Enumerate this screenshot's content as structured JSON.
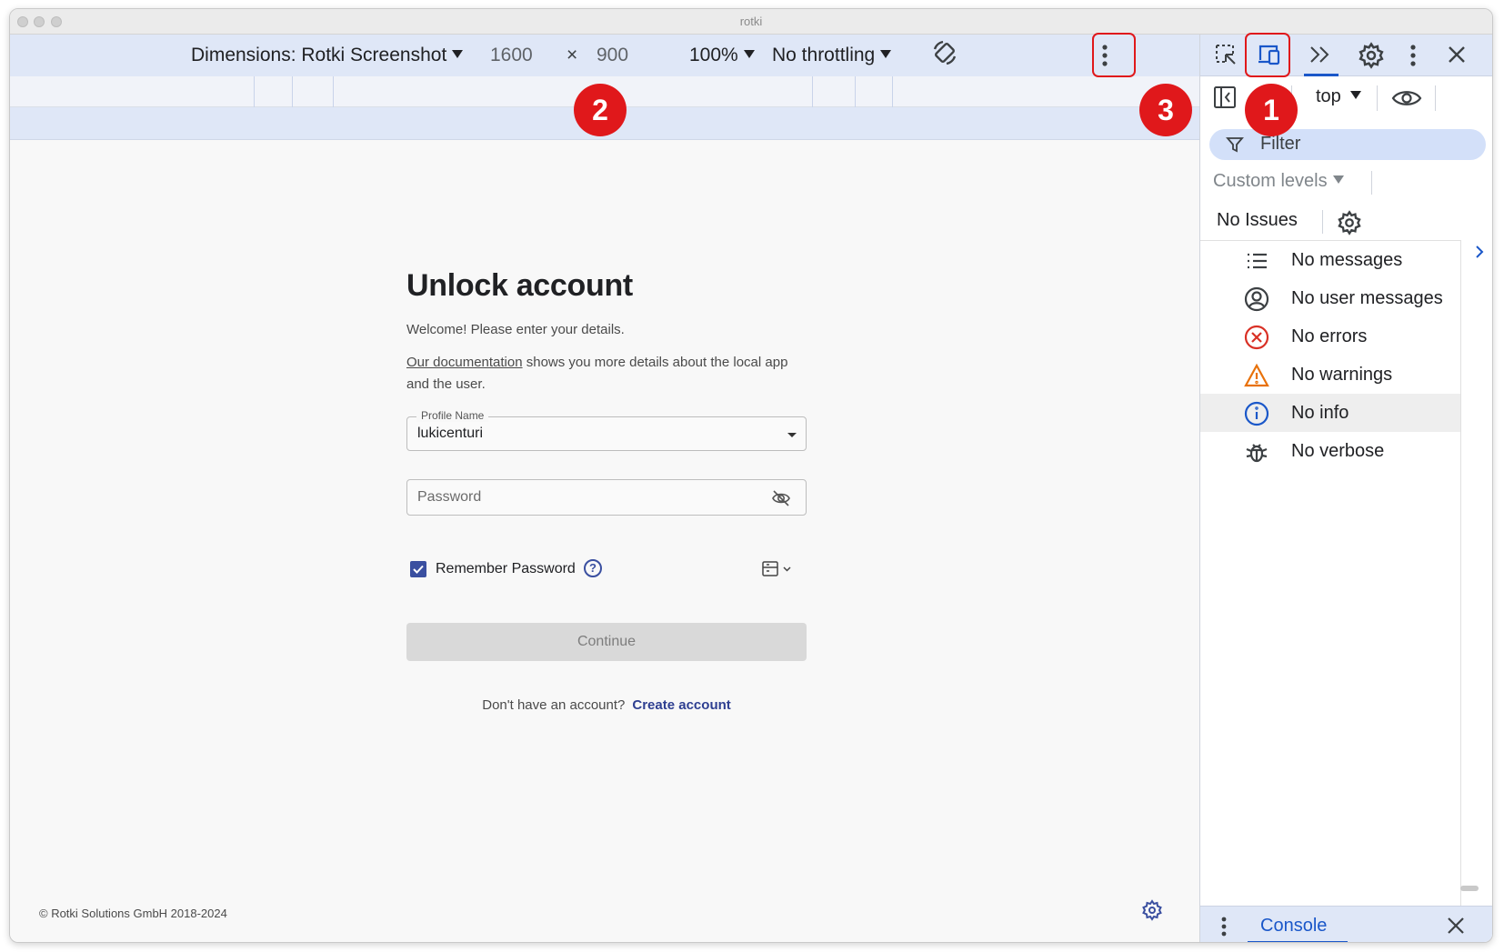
{
  "window": {
    "title": "rotki"
  },
  "device_toolbar": {
    "dimensions_label": "Dimensions: Rotki Screenshot",
    "width": "1600",
    "times": "×",
    "height": "900",
    "zoom": "100%",
    "throttling": "No throttling"
  },
  "annotations": {
    "badge1": "1",
    "badge2": "2",
    "badge3": "3",
    "color": "#e0181b"
  },
  "login": {
    "title": "Unlock account",
    "welcome": "Welcome! Please enter your details.",
    "doc_link": "Our documentation",
    "doc_text": " shows you more details about the local app and the user.",
    "profile_label": "Profile Name",
    "profile_value": "lukicenturi",
    "password_placeholder": "Password",
    "remember_label": "Remember Password",
    "continue_label": "Continue",
    "signup_prompt": "Don't have an account?",
    "create_account": "Create account",
    "accent": "#3a4fa0"
  },
  "footer": {
    "copyright": "© Rotki Solutions GmbH 2018-2024"
  },
  "devtools": {
    "context": "top",
    "filter": "Filter",
    "custom_levels": "Custom levels",
    "no_issues": "No Issues",
    "levels": [
      {
        "label": "No messages",
        "icon": "list-icon"
      },
      {
        "label": "No user messages",
        "icon": "user-circle-icon"
      },
      {
        "label": "No errors",
        "icon": "error-icon"
      },
      {
        "label": "No warnings",
        "icon": "warning-icon"
      },
      {
        "label": "No info",
        "icon": "info-icon"
      },
      {
        "label": "No verbose",
        "icon": "bug-icon"
      }
    ],
    "console_tab": "Console"
  }
}
